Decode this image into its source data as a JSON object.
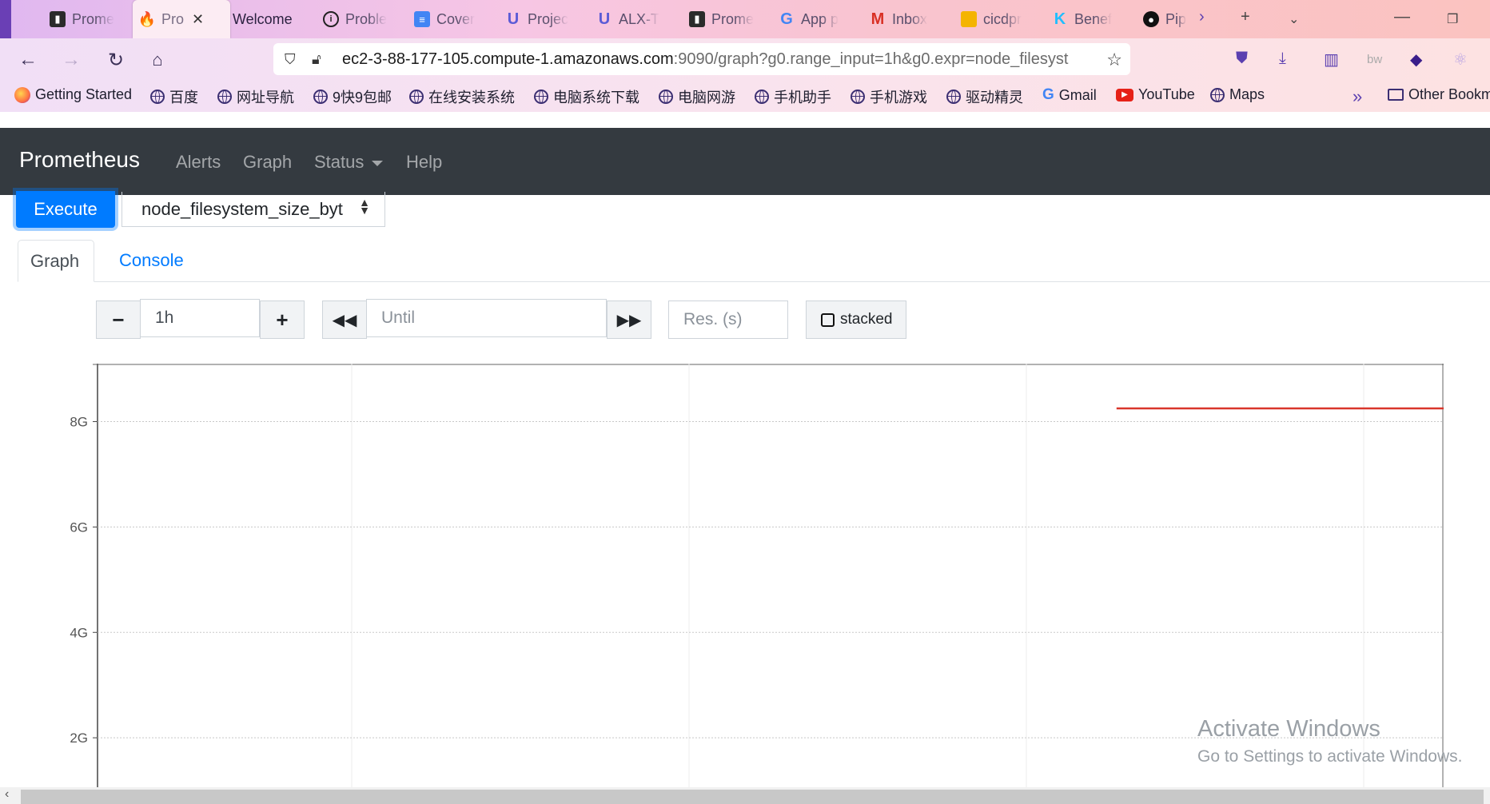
{
  "browser": {
    "tabs": [
      {
        "label": "Prome",
        "icon": "terminal-icon",
        "color": "#2b2b2b"
      },
      {
        "label": "Pro",
        "icon": "prometheus-icon",
        "color": "#e6522c",
        "active": true
      },
      {
        "label": "Welcome",
        "icon": "",
        "color": ""
      },
      {
        "label": "Proble",
        "icon": "info-icon",
        "color": "#222"
      },
      {
        "label": "Cover",
        "icon": "docs-icon",
        "color": "#4285f4"
      },
      {
        "label": "Projec",
        "icon": "u-logo-icon",
        "color": "#5b5bd6"
      },
      {
        "label": "ALX-T",
        "icon": "u-logo-icon",
        "color": "#5b5bd6"
      },
      {
        "label": "Prome",
        "icon": "terminal-icon",
        "color": "#2b2b2b"
      },
      {
        "label": "App p",
        "icon": "google-icon",
        "color": "#4285f4"
      },
      {
        "label": "Inbox",
        "icon": "gmail-icon",
        "color": "#d93025"
      },
      {
        "label": "cicdpr",
        "icon": "slides-icon",
        "color": "#f4b400"
      },
      {
        "label": "Benef",
        "icon": "kaggle-icon",
        "color": "#20beff"
      },
      {
        "label": "Pip",
        "icon": "circleci-icon",
        "color": "#111"
      }
    ],
    "url_host": "ec2-3-88-177-105.compute-1.amazonaws.com",
    "url_rest": ":9090/graph?g0.range_input=1h&g0.expr=node_filesyst",
    "bookmarks": [
      {
        "label": "Getting Started",
        "icon": "firefox-icon"
      },
      {
        "label": "百度",
        "icon": "globe-icon"
      },
      {
        "label": "网址导航",
        "icon": "globe-icon"
      },
      {
        "label": "9快9包邮",
        "icon": "globe-icon"
      },
      {
        "label": "在线安装系统",
        "icon": "globe-icon"
      },
      {
        "label": "电脑系统下载",
        "icon": "globe-icon"
      },
      {
        "label": "电脑网游",
        "icon": "globe-icon"
      },
      {
        "label": "手机助手",
        "icon": "globe-icon"
      },
      {
        "label": "手机游戏",
        "icon": "globe-icon"
      },
      {
        "label": "驱动精灵",
        "icon": "globe-icon"
      },
      {
        "label": "Gmail",
        "icon": "google-icon"
      },
      {
        "label": "YouTube",
        "icon": "youtube-icon"
      },
      {
        "label": "Maps",
        "icon": "globe-icon"
      }
    ],
    "other_bookmarks": "Other Bookm"
  },
  "navbar": {
    "brand": "Prometheus",
    "links": [
      "Alerts",
      "Graph",
      "Status",
      "Help"
    ]
  },
  "query": {
    "execute_label": "Execute",
    "expression": "node_filesystem_size_byt"
  },
  "tabs": {
    "graph": "Graph",
    "console": "Console"
  },
  "controls": {
    "range_minus": "−",
    "range_value": "1h",
    "range_plus": "+",
    "until_placeholder": "Until",
    "resolution_placeholder": "Res. (s)",
    "stacked_label": "stacked"
  },
  "chart_data": {
    "type": "line",
    "y_tick_labels": [
      "8G",
      "6G",
      "4G",
      "2G"
    ],
    "y_ticks": [
      8,
      6,
      4,
      2
    ],
    "ylim": [
      0,
      9.1
    ],
    "grid": true,
    "series": [
      {
        "color": "#d9362b",
        "x": [
          0.757,
          1.0
        ],
        "values": [
          8.25,
          8.25
        ]
      }
    ]
  },
  "watermark": {
    "title": "Activate Windows",
    "subtitle": "Go to Settings to activate Windows."
  }
}
